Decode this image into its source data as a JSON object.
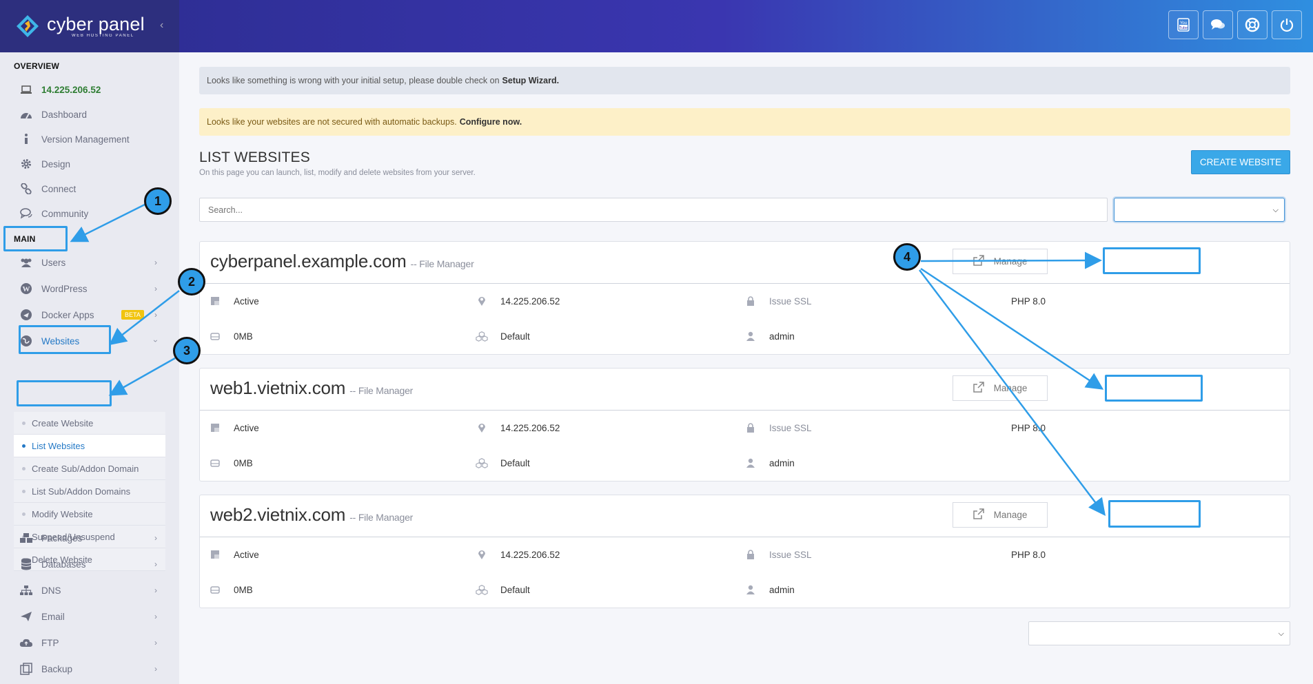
{
  "header": {
    "logo_title": "cyber panel",
    "logo_subtitle": "WEB HOSTING PANEL",
    "buttons": [
      {
        "icon": "youtube-icon"
      },
      {
        "icon": "chat-icon"
      },
      {
        "icon": "lifebuoy-icon"
      },
      {
        "icon": "power-icon"
      }
    ]
  },
  "sidebar": {
    "overview_label": "OVERVIEW",
    "ip": "14.225.206.52",
    "overview_items": [
      {
        "label": "Dashboard",
        "icon": "dashboard-icon"
      },
      {
        "label": "Version Management",
        "icon": "info-icon"
      },
      {
        "label": "Design",
        "icon": "gear-icon"
      },
      {
        "label": "Connect",
        "icon": "link-icon"
      },
      {
        "label": "Community",
        "icon": "comments-icon"
      }
    ],
    "main_label": "MAIN",
    "main_items": [
      {
        "label": "Users",
        "icon": "users-icon"
      },
      {
        "label": "WordPress",
        "icon": "wordpress-icon"
      },
      {
        "label": "Docker Apps",
        "icon": "docker-icon",
        "badge": "BETA"
      },
      {
        "label": "Websites",
        "icon": "globe-icon"
      }
    ],
    "websites_submenu": [
      "Create Website",
      "List Websites",
      "Create Sub/Addon Domain",
      "List Sub/Addon Domains",
      "Modify Website",
      "Suspend/Unsuspend",
      "Delete Website"
    ],
    "lower_items": [
      {
        "label": "Packages",
        "icon": "packages-icon"
      },
      {
        "label": "Databases",
        "icon": "database-icon"
      },
      {
        "label": "DNS",
        "icon": "sitemap-icon"
      },
      {
        "label": "Email",
        "icon": "paper-plane-icon"
      },
      {
        "label": "FTP",
        "icon": "cloud-upload-icon"
      },
      {
        "label": "Backup",
        "icon": "backup-icon"
      }
    ]
  },
  "alerts": {
    "setup_text": "Looks like something is wrong with your initial setup, please double check on",
    "setup_link": "Setup Wizard.",
    "backup_text": "Looks like your websites are not secured with automatic backups.",
    "backup_link": "Configure now."
  },
  "page": {
    "title": "LIST WEBSITES",
    "subtitle": "On this page you can launch, list, modify and delete websites from your server.",
    "create_button": "CREATE WEBSITE",
    "search_placeholder": "Search..."
  },
  "websites": [
    {
      "domain": "cyberpanel.example.com",
      "file_manager": "-- File Manager",
      "manage": "Manage",
      "status": "Active",
      "ip": "14.225.206.52",
      "ssl": "Issue SSL",
      "php": "PHP 8.0",
      "disk": "0MB",
      "package": "Default",
      "owner": "admin"
    },
    {
      "domain": "web1.vietnix.com",
      "file_manager": "-- File Manager",
      "manage": "Manage",
      "status": "Active",
      "ip": "14.225.206.52",
      "ssl": "Issue SSL",
      "php": "PHP 8.0",
      "disk": "0MB",
      "package": "Default",
      "owner": "admin"
    },
    {
      "domain": "web2.vietnix.com",
      "file_manager": "-- File Manager",
      "manage": "Manage",
      "status": "Active",
      "ip": "14.225.206.52",
      "ssl": "Issue SSL",
      "php": "PHP 8.0",
      "disk": "0MB",
      "package": "Default",
      "owner": "admin"
    }
  ],
  "annotations": [
    "1",
    "2",
    "3",
    "4"
  ],
  "colors": {
    "accent": "#2f9de8",
    "ip_green": "#2e7d32",
    "create_button": "#3aa8e8"
  }
}
